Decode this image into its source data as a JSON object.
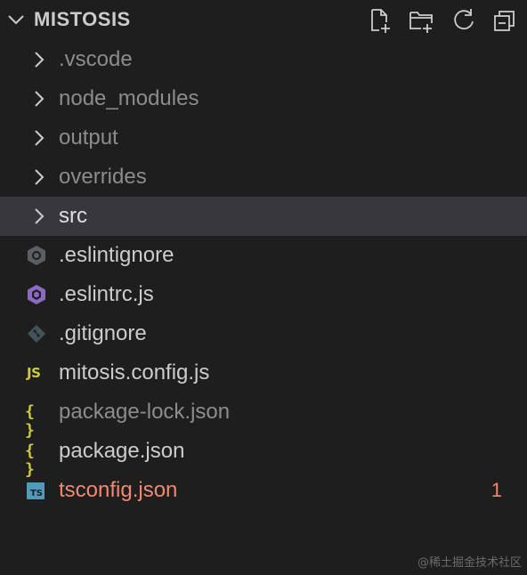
{
  "explorer": {
    "title": "MISTOSIS",
    "actions": [
      {
        "name": "new-file",
        "icon": "new-file-icon"
      },
      {
        "name": "new-folder",
        "icon": "new-folder-icon"
      },
      {
        "name": "refresh",
        "icon": "refresh-icon"
      },
      {
        "name": "collapse-all",
        "icon": "collapse-all-icon"
      }
    ]
  },
  "tree": {
    "items": [
      {
        "label": ".vscode",
        "type": "folder",
        "icon": "chevron-right-icon"
      },
      {
        "label": "node_modules",
        "type": "folder",
        "icon": "chevron-right-icon"
      },
      {
        "label": "output",
        "type": "folder",
        "icon": "chevron-right-icon"
      },
      {
        "label": "overrides",
        "type": "folder",
        "icon": "chevron-right-icon"
      },
      {
        "label": "src",
        "type": "folder",
        "icon": "chevron-right-icon",
        "selected": true
      },
      {
        "label": ".eslintignore",
        "type": "file",
        "icon": "eslintignore-icon"
      },
      {
        "label": ".eslintrc.js",
        "type": "file",
        "icon": "eslint-icon"
      },
      {
        "label": ".gitignore",
        "type": "file",
        "icon": "git-icon"
      },
      {
        "label": "mitosis.config.js",
        "type": "file",
        "icon": "js-file-icon",
        "icon_text": "JS"
      },
      {
        "label": "package-lock.json",
        "type": "file",
        "icon": "json-file-icon",
        "icon_text": "{ }"
      },
      {
        "label": "package.json",
        "type": "file",
        "icon": "json-file-icon",
        "icon_text": "{ }"
      },
      {
        "label": "tsconfig.json",
        "type": "file",
        "icon": "ts-file-icon",
        "icon_text": "TS",
        "badge": "1"
      }
    ]
  },
  "watermark": "@稀土掘金技术社区",
  "colors": {
    "background": "#1e1e1e",
    "selected_row": "#37373d",
    "text": "#cccccc",
    "dim_text": "#8c8c8c",
    "error": "#f48771",
    "json_yellow": "#cbcb41",
    "ts_blue": "#519aba",
    "eslint_purple": "#8b6bc2"
  }
}
